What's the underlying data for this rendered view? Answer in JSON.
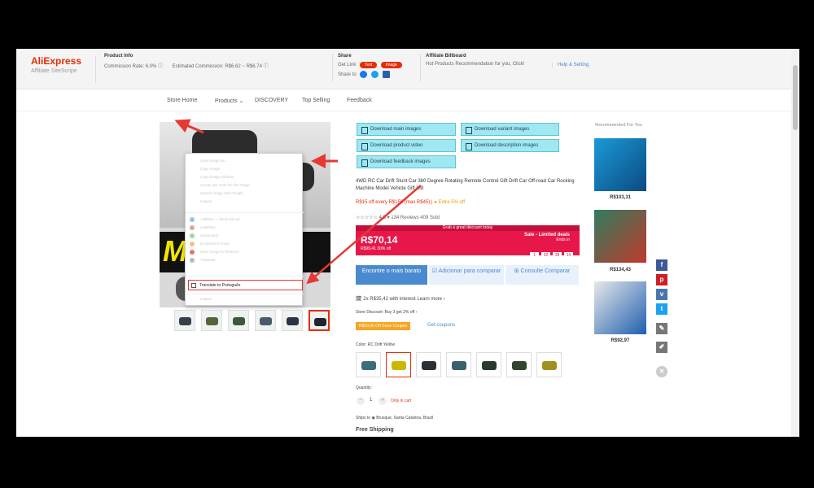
{
  "affiliate": {
    "logo": "AliExpress",
    "logo_sub": "Affiliate SiteScripe",
    "product_info_title": "Product Info",
    "commission_rate": "Commission Rate: 6.0% ⓘ",
    "estimated_commission": "Estimated Commission: R$6.62 ~ R$6.74 ⓘ",
    "share_title": "Share",
    "get_link_label": "Get Link",
    "text_btn": "Text",
    "image_btn": "Image",
    "share_to_label": "Share to",
    "billboard_title": "Affiliate Billboard",
    "billboard_link": "Hot Products Recommendation for you, Click!",
    "help_link": "Help & Setting"
  },
  "nav": [
    "Store Home",
    "Products ⌄",
    "DISCOVERY",
    "Top Selling",
    "Feedback"
  ],
  "context_menu": {
    "items": [
      "Save image as...",
      "Copy image",
      "Copy image address",
      "Create QR code for this image",
      "Search image with Google",
      "Inspect"
    ],
    "items2": [
      "AdBlock — block this ad",
      "LastPass",
      "Grammarly",
      "Ecommerce Tools",
      "Save image to Pinterest",
      "Translate"
    ],
    "highlighted": "Translate to Português",
    "last": "Inspect"
  },
  "downloads": [
    "Download main images",
    "Download variant images",
    "Download product video",
    "Download description images",
    "Download feedback images"
  ],
  "product": {
    "title": "4WD RC Car Drift Stunt Car 360 Degree Rotating Remote Control Gift Drift Car Off-road Car Rocking Machine Model Vehicle Gift Kid",
    "promo_red": "R$15 off every R$150 (max R$45) | ",
    "promo_yellow": "● Extra 5% off",
    "rating": "☆☆☆☆☆ 4.8 ▾   134 Reviews   409 Sold",
    "deal_top": "Grab a great discount today",
    "price": "R$70,14",
    "old_price": "R$99,41  30% off",
    "sale_label": "Sale - Limited deals",
    "sale_sub": "Ends in",
    "timer": [
      "1",
      "02",
      "38",
      "14"
    ],
    "cmp_cheapest": "Encontre o mais barato",
    "cmp_add": "☑ Adicionar para comparar",
    "cmp_view": "⊞ Consulte Comparar",
    "installments": "🗓 2x R$35,42 with interest  Learn more ›",
    "discount_label": "Store Discount: Buy 3 get 2% off ›",
    "coupon": "R$10,00 Off Store Coupon",
    "coupon_link": "Get coupons",
    "color_label": "Color: RC Drift Yellow",
    "quantity_label": "Quantity:",
    "qty": "1",
    "qty_note": "Only in cart",
    "ships_to": "Ships to ◉ Brusque, Santa Catarina, Brazil",
    "shipping": "Free Shipping"
  },
  "recommended": {
    "title": "Recommended For You",
    "prices": [
      "R$103,31",
      "R$134,43",
      "R$92,97"
    ]
  },
  "colors": {
    "accent": "#e62e04",
    "link": "#4a8ad0",
    "deal": "#e8174a",
    "download": "#9fe8f2"
  }
}
